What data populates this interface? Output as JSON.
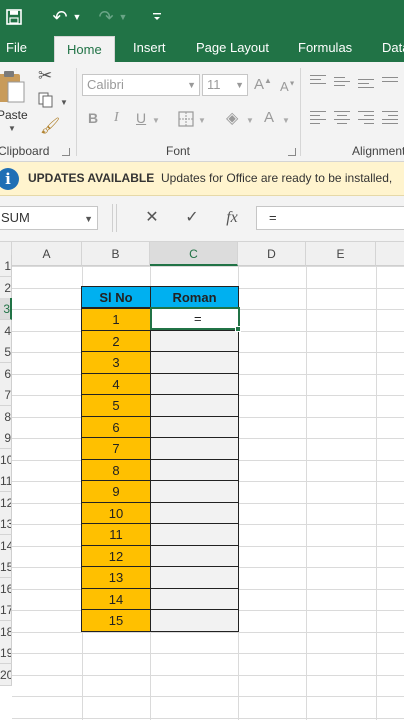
{
  "quick_access": {
    "undo_glyph": "↶",
    "redo_glyph": "↷"
  },
  "tabs": [
    {
      "label": "File",
      "active": false
    },
    {
      "label": "Home",
      "active": true
    },
    {
      "label": "Insert",
      "active": false
    },
    {
      "label": "Page Layout",
      "active": false
    },
    {
      "label": "Formulas",
      "active": false
    },
    {
      "label": "Data",
      "active": false
    }
  ],
  "ribbon": {
    "clipboard": {
      "paste_label": "Paste",
      "group_label": "Clipboard"
    },
    "font": {
      "group_label": "Font",
      "font_name": "Calibri",
      "font_size": "11",
      "grow_label": "A",
      "shrink_label": "A",
      "bold": "B",
      "italic": "I",
      "underline": "U",
      "font_color": "A"
    },
    "alignment": {
      "group_label": "Alignment"
    }
  },
  "infobar": {
    "title": "UPDATES AVAILABLE",
    "message": "Updates for Office are ready to be installed,"
  },
  "formula_bar": {
    "name_box": "SUM",
    "cancel": "✕",
    "enter": "✓",
    "fx": "fx",
    "formula": "="
  },
  "columns": [
    "A",
    "B",
    "C",
    "D",
    "E"
  ],
  "rows": [
    "1",
    "2",
    "3",
    "4",
    "5",
    "6",
    "7",
    "8",
    "9",
    "10",
    "11",
    "12",
    "13",
    "14",
    "15",
    "16",
    "17",
    "18",
    "19",
    "20"
  ],
  "selected_column": "C",
  "selected_row": "3",
  "table": {
    "headers": [
      "Sl No",
      "Roman"
    ],
    "sl_no": [
      "1",
      "2",
      "3",
      "4",
      "5",
      "6",
      "7",
      "8",
      "9",
      "10",
      "11",
      "12",
      "13",
      "14",
      "15"
    ],
    "roman": [
      "",
      "",
      "",
      "",
      "",
      "",
      "",
      "",
      "",
      "",
      "",
      "",
      "",
      "",
      ""
    ]
  },
  "colors": {
    "excel_green": "#217346",
    "header_fill": "#00b0f0",
    "slno_fill": "#ffc000",
    "roman_fill": "#f2f2f2"
  }
}
